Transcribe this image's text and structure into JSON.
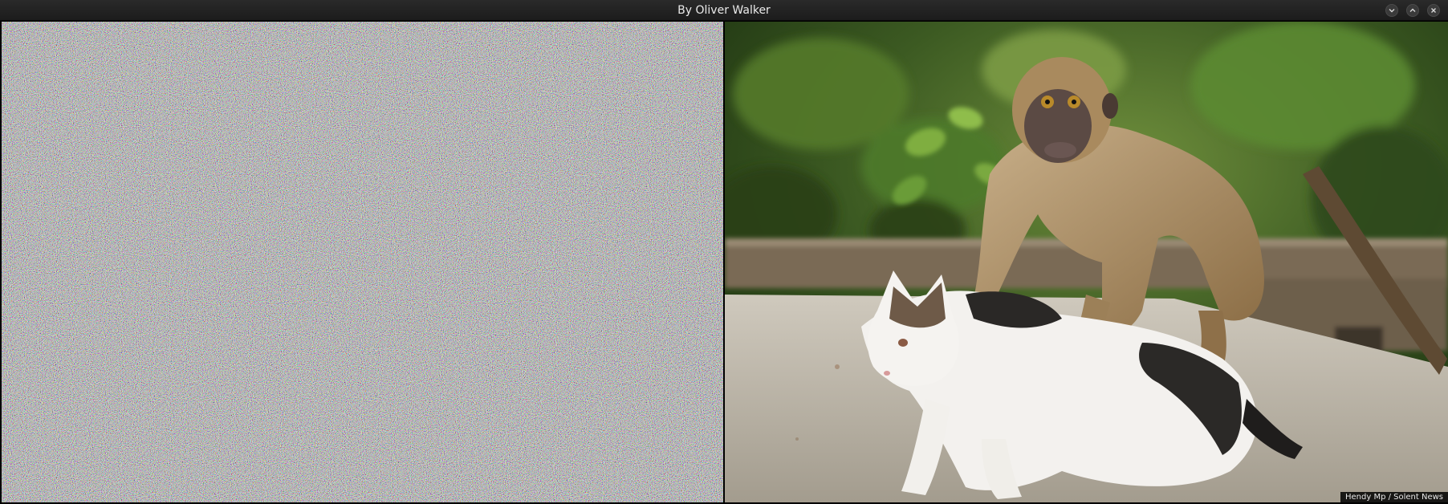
{
  "window": {
    "title": "By Oliver Walker",
    "controls": {
      "minimize_icon": "chevron-down-icon",
      "maximize_icon": "chevron-up-icon",
      "close_icon": "close-icon"
    }
  },
  "panels": {
    "left": {
      "content": "random-color-noise"
    },
    "right": {
      "content": "photo-monkey-riding-cat",
      "credit": "Hendy Mp /   Solent News"
    }
  },
  "colors": {
    "titlebar": "#1f1f1f",
    "title_text": "#eaeaea",
    "foliage": "#3b5a2a",
    "ground": "#b8b2a6"
  }
}
